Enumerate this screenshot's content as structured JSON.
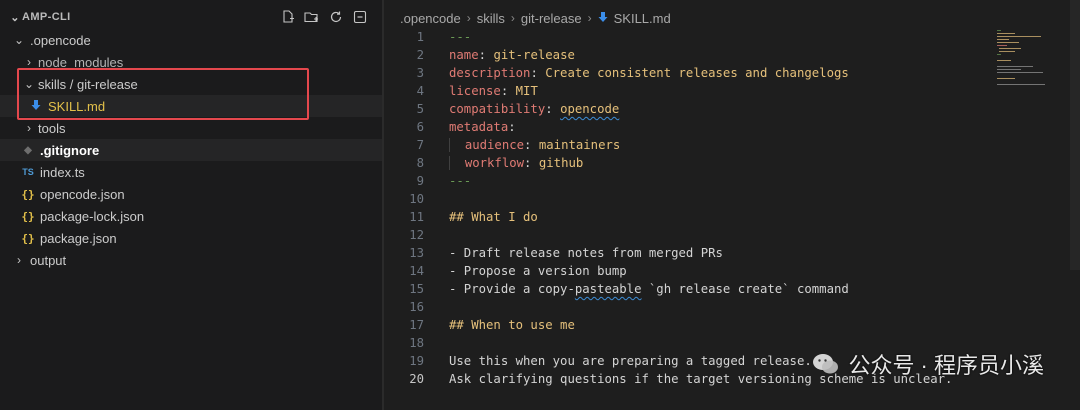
{
  "explorer": {
    "title": "AMP-CLI",
    "actions": [
      "new-file-icon",
      "new-folder-icon",
      "refresh-icon",
      "collapse-all-icon"
    ],
    "items": [
      {
        "label": ".opencode",
        "kind": "folder-open"
      },
      {
        "label": "node_modules",
        "kind": "folder"
      },
      {
        "label": "skills / git-release",
        "kind": "folder-open"
      },
      {
        "label": "SKILL.md",
        "kind": "markdown"
      },
      {
        "label": "tools",
        "kind": "folder"
      },
      {
        "label": ".gitignore",
        "kind": "git"
      },
      {
        "label": "index.ts",
        "kind": "ts"
      },
      {
        "label": "opencode.json",
        "kind": "json"
      },
      {
        "label": "package-lock.json",
        "kind": "json"
      },
      {
        "label": "package.json",
        "kind": "json"
      },
      {
        "label": "output",
        "kind": "folder"
      }
    ],
    "highlight_color": "#e5484d"
  },
  "editor": {
    "breadcrumb": [
      ".opencode",
      "skills",
      "git-release",
      "SKILL.md"
    ],
    "current_line": 20,
    "line_numbers": [
      "1",
      "2",
      "3",
      "4",
      "5",
      "6",
      "7",
      "8",
      "9",
      "10",
      "11",
      "12",
      "13",
      "14",
      "15",
      "16",
      "17",
      "18",
      "19",
      "20"
    ],
    "code": {
      "l1": "---",
      "l2_key": "name",
      "l2_val": "git-release",
      "l3_key": "description",
      "l3_val": "Create consistent releases and changelogs",
      "l4_key": "license",
      "l4_val": "MIT",
      "l5_key": "compatibility",
      "l5_val": "opencode",
      "l6_key": "metadata",
      "l7_key": "audience",
      "l7_val": "maintainers",
      "l8_key": "workflow",
      "l8_val": "github",
      "l9": "---",
      "l11": "## What I do",
      "l13": "- Draft release notes from merged PRs",
      "l14": "- Propose a version bump",
      "l15_a": "- Provide a copy-",
      "l15_b": "pasteable",
      "l15_c": " `gh release create` command",
      "l17": "## When to use me",
      "l19": "Use this when you are preparing a tagged release.",
      "l20": "Ask clarifying questions if the target versioning scheme is unclear."
    }
  },
  "watermark": {
    "text": "公众号 · 程序员小溪",
    "icon": "wechat-icon"
  }
}
